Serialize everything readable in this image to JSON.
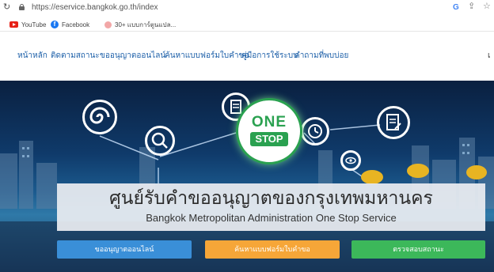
{
  "browser": {
    "url": "https://eservice.bangkok.go.th/index",
    "bookmarks": [
      {
        "label": "YouTube",
        "icon": "youtube-icon"
      },
      {
        "label": "Facebook",
        "icon": "facebook-icon"
      },
      {
        "label": "30+ แบบการ์ตูนแปล...",
        "icon": "site-icon"
      }
    ]
  },
  "nav": {
    "items": [
      "หน้าหลัก",
      "ติดตามสถานะ",
      "ขออนุญาตออนไลน์",
      "ค้นหาแบบฟอร์มใบคำขอ",
      "คู่มือการใช้ระบบ",
      "คำถามที่พบบ่อย"
    ],
    "more": "เ"
  },
  "hero": {
    "logo_top": "ONE",
    "logo_bottom": "STOP",
    "title_th": "ศูนย์รับคำขออนุญาตของกรุงเทพมหานคร",
    "title_en": "Bangkok Metropolitan Administration One Stop Service",
    "buttons": [
      "ขออนุญาตออนไลน์",
      "ค้นหาแบบฟอร์มใบคำขอ",
      "ตรวจสอบสถานะ"
    ]
  },
  "colors": {
    "nav_text": "#1c5fa8",
    "logo_green": "#2aa150",
    "button_blue": "#3a8fd8",
    "button_orange": "#f6a638",
    "button_green": "#3cb85a"
  }
}
